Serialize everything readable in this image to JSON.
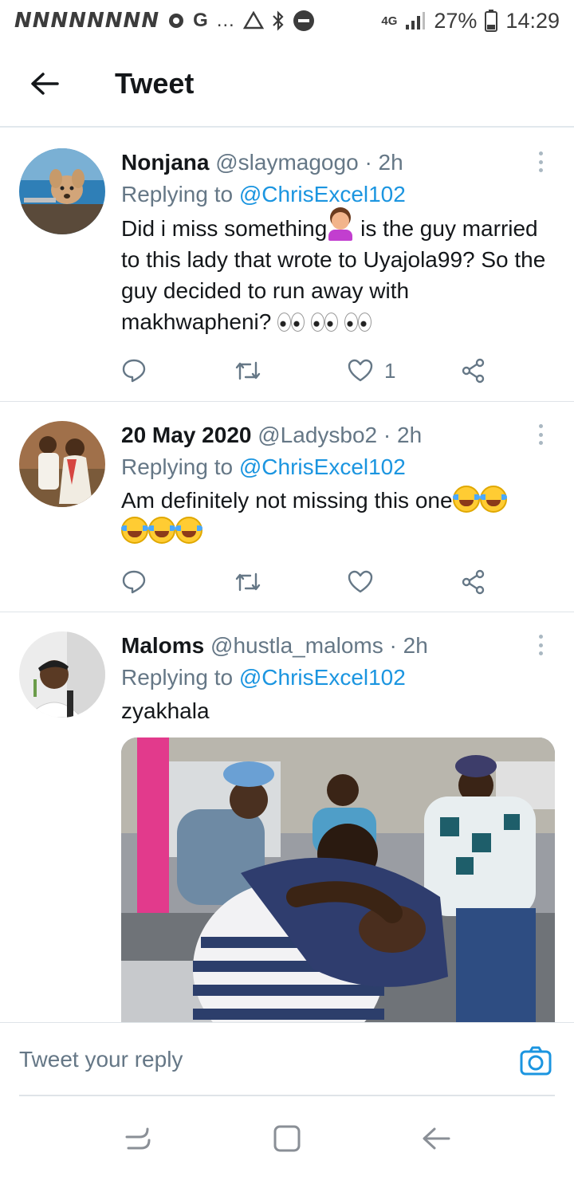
{
  "status_bar": {
    "left_glyphs": "NNNNNNNN",
    "g_label": "G",
    "dots": "…",
    "network": "4G",
    "battery": "27%",
    "time": "14:29"
  },
  "header": {
    "title": "Tweet"
  },
  "tweets": [
    {
      "name": "Nonjana",
      "handle": "@slaymagogo",
      "time": "2h",
      "replying_prefix": "Replying to",
      "replying_to": "@ChrisExcel102",
      "text_parts": [
        "Did i miss something",
        " is the guy married to this lady that wrote to Uyajola99? So the guy decided to run away with makhwapheni? "
      ],
      "emoji": [
        "information_desk_person",
        "eyes",
        "eyes",
        "eyes"
      ],
      "like_count": "1",
      "avatar_colors": [
        "#2f7fb7",
        "#c79a6a",
        "#5a4a3a"
      ]
    },
    {
      "name": "20 May 2020",
      "handle": "@Ladysbo2",
      "time": "2h",
      "replying_prefix": "Replying to",
      "replying_to": "@ChrisExcel102",
      "text_parts": [
        "Am definitely not missing this one"
      ],
      "emoji": [
        "joy",
        "joy",
        "joy",
        "joy",
        "joy"
      ],
      "like_count": "",
      "avatar_colors": [
        "#a0704a",
        "#e8e1d6",
        "#c0392b"
      ]
    },
    {
      "name": "Maloms",
      "handle": "@hustla_maloms",
      "time": "2h",
      "replying_prefix": "Replying to",
      "replying_to": "@ChrisExcel102",
      "text_parts": [
        "zyakhala"
      ],
      "emoji": [],
      "like_count": "",
      "avatar_colors": [
        "#e8e8e8",
        "#2a2a2a",
        "#6b9c4a"
      ]
    }
  ],
  "reply": {
    "placeholder": "Tweet your reply"
  },
  "colors": {
    "accent": "#1b95e0",
    "secondary_text": "#657786",
    "divider": "#dfe4e8"
  },
  "icons": {
    "back": "arrow-left-icon",
    "more": "more-vertical-icon",
    "reply": "comment-icon",
    "retweet": "retweet-icon",
    "like": "heart-icon",
    "share": "share-icon",
    "camera": "camera-icon",
    "nav_recent": "recents-icon",
    "nav_home": "home-icon",
    "nav_back": "back-icon"
  }
}
